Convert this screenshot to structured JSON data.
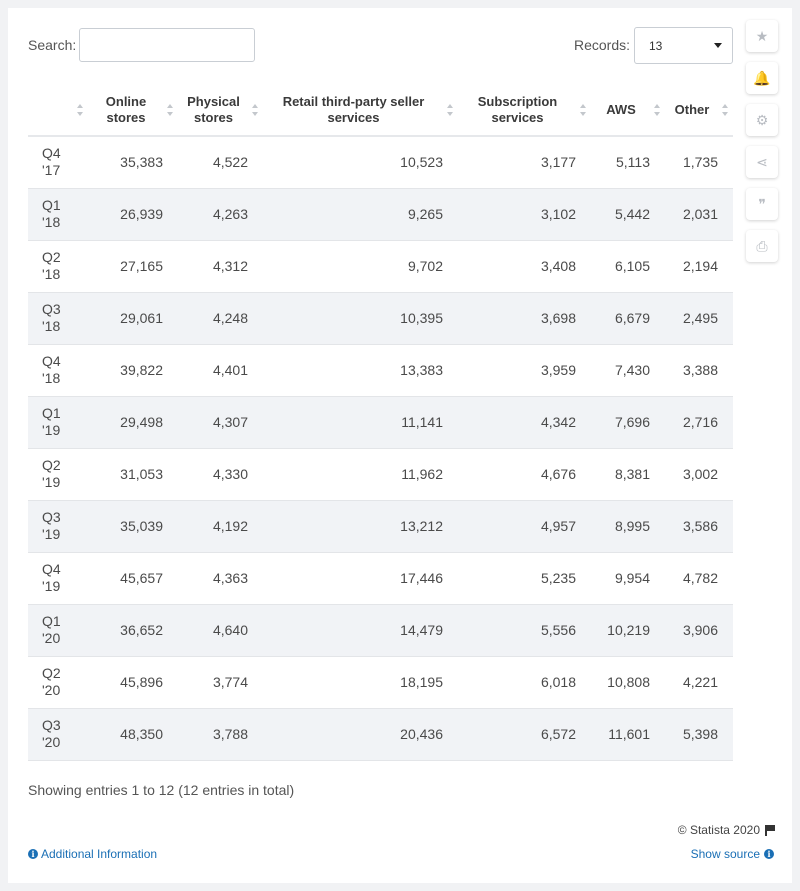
{
  "search": {
    "label": "Search:",
    "value": ""
  },
  "records": {
    "label": "Records:",
    "selected": "13"
  },
  "toolbar": [
    {
      "name": "star-icon",
      "glyph": "★"
    },
    {
      "name": "bell-icon",
      "glyph": "🔔"
    },
    {
      "name": "gear-icon",
      "glyph": "⚙"
    },
    {
      "name": "share-icon",
      "glyph": "⋖"
    },
    {
      "name": "quote-icon",
      "glyph": "❞"
    },
    {
      "name": "print-icon",
      "glyph": "⎙"
    }
  ],
  "table": {
    "columns": [
      {
        "key": "quarter",
        "label": ""
      },
      {
        "key": "online",
        "label": "Online stores"
      },
      {
        "key": "physical",
        "label": "Physical stores"
      },
      {
        "key": "thirdparty",
        "label": "Retail third-party seller services"
      },
      {
        "key": "subscription",
        "label": "Subscription services"
      },
      {
        "key": "aws",
        "label": "AWS"
      },
      {
        "key": "other",
        "label": "Other"
      }
    ],
    "rows": [
      [
        "Q4 '17",
        "35,383",
        "4,522",
        "10,523",
        "3,177",
        "5,113",
        "1,735"
      ],
      [
        "Q1 '18",
        "26,939",
        "4,263",
        "9,265",
        "3,102",
        "5,442",
        "2,031"
      ],
      [
        "Q2 '18",
        "27,165",
        "4,312",
        "9,702",
        "3,408",
        "6,105",
        "2,194"
      ],
      [
        "Q3 '18",
        "29,061",
        "4,248",
        "10,395",
        "3,698",
        "6,679",
        "2,495"
      ],
      [
        "Q4 '18",
        "39,822",
        "4,401",
        "13,383",
        "3,959",
        "7,430",
        "3,388"
      ],
      [
        "Q1 '19",
        "29,498",
        "4,307",
        "11,141",
        "4,342",
        "7,696",
        "2,716"
      ],
      [
        "Q2 '19",
        "31,053",
        "4,330",
        "11,962",
        "4,676",
        "8,381",
        "3,002"
      ],
      [
        "Q3 '19",
        "35,039",
        "4,192",
        "13,212",
        "4,957",
        "8,995",
        "3,586"
      ],
      [
        "Q4 '19",
        "45,657",
        "4,363",
        "17,446",
        "5,235",
        "9,954",
        "4,782"
      ],
      [
        "Q1 '20",
        "36,652",
        "4,640",
        "14,479",
        "5,556",
        "10,219",
        "3,906"
      ],
      [
        "Q2 '20",
        "45,896",
        "3,774",
        "18,195",
        "6,018",
        "10,808",
        "4,221"
      ],
      [
        "Q3 '20",
        "48,350",
        "3,788",
        "20,436",
        "6,572",
        "11,601",
        "5,398"
      ]
    ]
  },
  "footer": {
    "showing": "Showing entries 1 to 12 (12 entries in total)",
    "copyright": "© Statista 2020",
    "additional_info": "Additional Information",
    "show_source": "Show source"
  }
}
